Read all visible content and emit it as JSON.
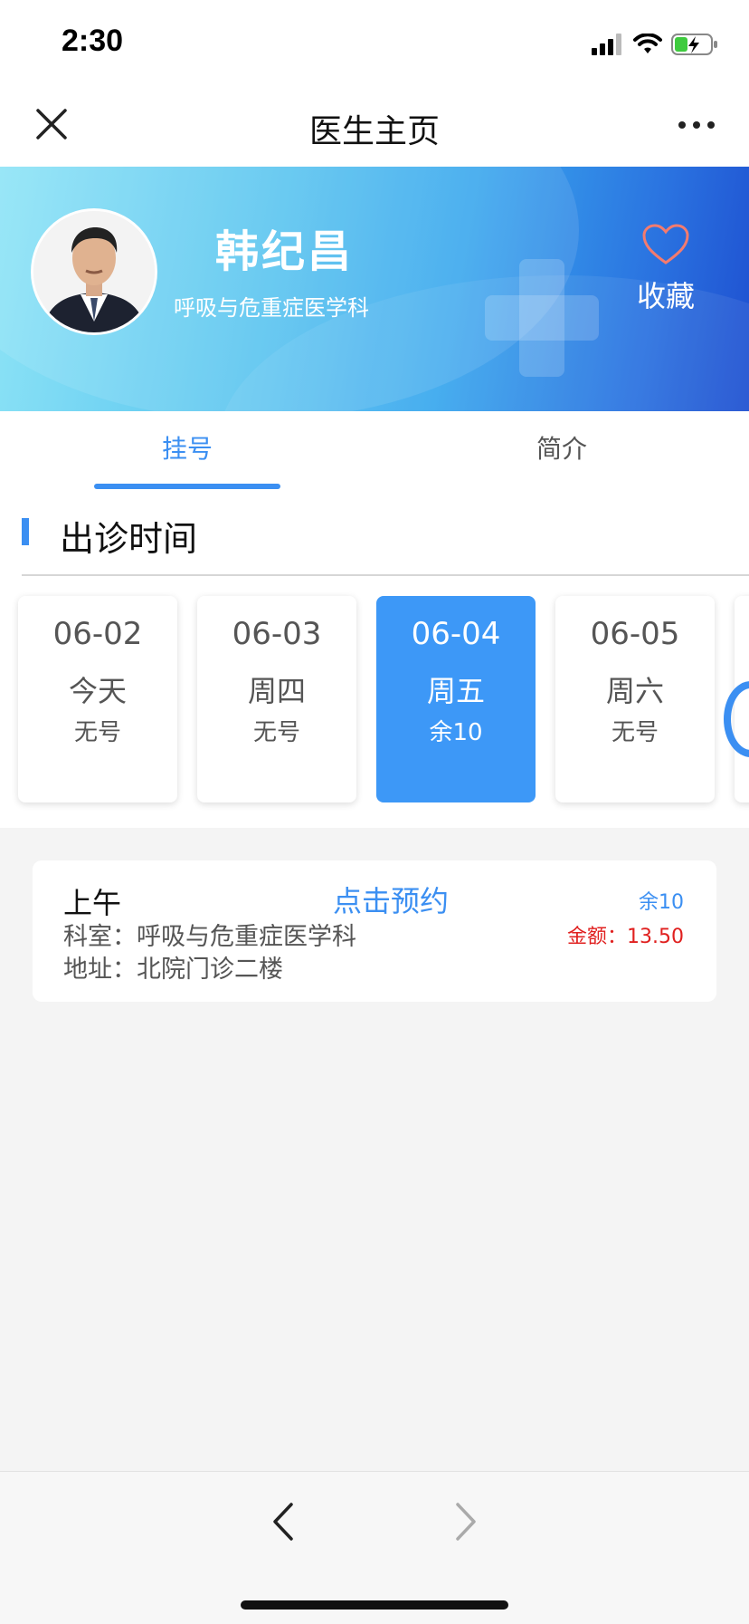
{
  "status_bar": {
    "time": "2:30",
    "icons": [
      "cellular-signal-icon",
      "wifi-icon",
      "battery-charging-icon"
    ]
  },
  "nav": {
    "title": "医生主页",
    "close_icon": "close-icon",
    "more_icon": "more-dots-icon"
  },
  "doctor": {
    "name": "韩纪昌",
    "department": "呼吸与危重症医学科",
    "favorite_label": "收藏",
    "favorite_icon": "heart-outline-icon"
  },
  "tabs": [
    {
      "label": "挂号",
      "active": true
    },
    {
      "label": "简介",
      "active": false
    }
  ],
  "schedule": {
    "title": "出诊时间",
    "days": [
      {
        "date": "06-02",
        "weekday": "今天",
        "availability": "无号"
      },
      {
        "date": "06-03",
        "weekday": "周四",
        "availability": "无号"
      },
      {
        "date": "06-04",
        "weekday": "周五",
        "availability": "余10"
      },
      {
        "date": "06-05",
        "weekday": "周六",
        "availability": "无号"
      }
    ],
    "selected_index": 2
  },
  "slot": {
    "period": "上午",
    "book_label": "点击预约",
    "remaining": "余10",
    "department": "科室：呼吸与危重症医学科",
    "fee": "金额：13.50",
    "address": "地址：北院门诊二楼"
  },
  "bottom_nav": {
    "back_icon": "chevron-left-icon",
    "forward_icon": "chevron-right-icon"
  },
  "colors": {
    "accent": "#3b8ff2",
    "fee_red": "#e0201f",
    "fav_heart": "#f47b6e"
  }
}
